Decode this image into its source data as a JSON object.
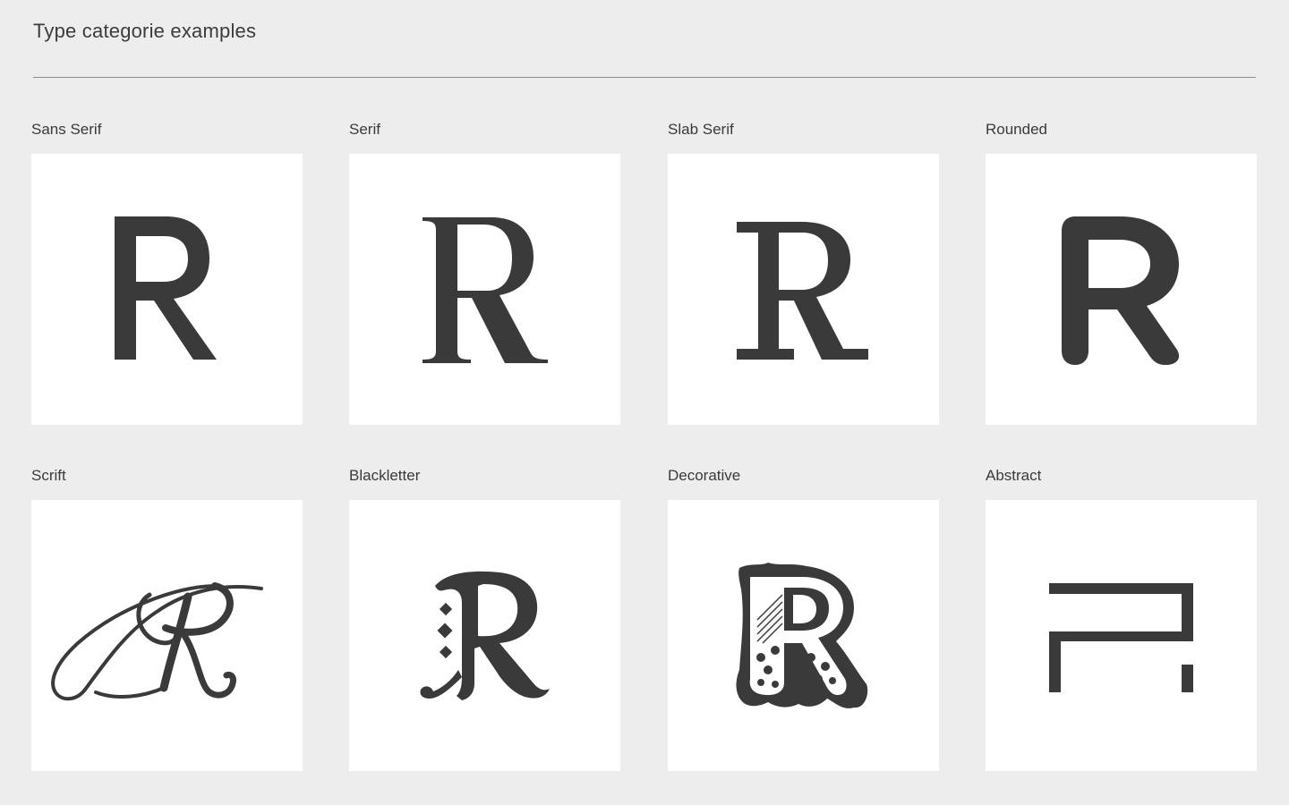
{
  "page": {
    "title": "Type categorie examples"
  },
  "colors": {
    "background": "#ededed",
    "tile": "#ffffff",
    "glyph": "#3a3a3a",
    "rule": "#8e8e8e"
  },
  "categories": [
    {
      "label": "Sans Serif",
      "glyph_icon": "sans-serif-r-icon"
    },
    {
      "label": "Serif",
      "glyph_icon": "serif-r-icon"
    },
    {
      "label": "Slab Serif",
      "glyph_icon": "slab-serif-r-icon"
    },
    {
      "label": "Rounded",
      "glyph_icon": "rounded-r-icon"
    },
    {
      "label": "Scrift",
      "glyph_icon": "script-r-icon"
    },
    {
      "label": "Blackletter",
      "glyph_icon": "blackletter-r-icon"
    },
    {
      "label": "Decorative",
      "glyph_icon": "decorative-r-icon"
    },
    {
      "label": "Abstract",
      "glyph_icon": "abstract-r-icon"
    }
  ]
}
